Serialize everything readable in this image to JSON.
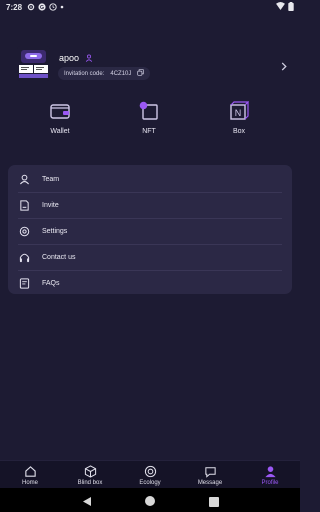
{
  "status_bar": {
    "time": "7:28",
    "status_icons": [
      "settings-icon",
      "g-icon",
      "clock-icon",
      "dot-icon"
    ],
    "system_icons": [
      "wifi-icon",
      "battery-icon"
    ]
  },
  "profile": {
    "username": "apoo",
    "invitation_label": "Invitation code:",
    "invitation_code": "4CZ10J",
    "user_icon": "user-icon",
    "copy_icon": "copy-icon",
    "chevron_icon": "chevron-right-icon"
  },
  "quick_actions": [
    {
      "label": "Wallet",
      "icon": "wallet-icon"
    },
    {
      "label": "NFT",
      "icon": "nft-icon"
    },
    {
      "label": "Box",
      "icon": "box-icon"
    }
  ],
  "menu": {
    "items": [
      {
        "label": "Team",
        "icon": "team-icon"
      },
      {
        "label": "Invite",
        "icon": "invite-icon"
      },
      {
        "label": "Settings",
        "icon": "settings-icon"
      },
      {
        "label": "Contact us",
        "icon": "headphones-icon"
      },
      {
        "label": "FAQs",
        "icon": "faq-icon"
      }
    ]
  },
  "bottom_nav": {
    "items": [
      {
        "label": "Home",
        "icon": "home-icon"
      },
      {
        "label": "Blind box",
        "icon": "blind-box-icon"
      },
      {
        "label": "Ecology",
        "icon": "ecology-icon"
      },
      {
        "label": "Message",
        "icon": "message-icon"
      },
      {
        "label": "Profile",
        "icon": "profile-icon"
      }
    ],
    "active": "Profile"
  },
  "colors": {
    "background": "#1d1b33",
    "card": "#2b2845",
    "accent": "#9b58f5",
    "nav_background": "#151327"
  }
}
